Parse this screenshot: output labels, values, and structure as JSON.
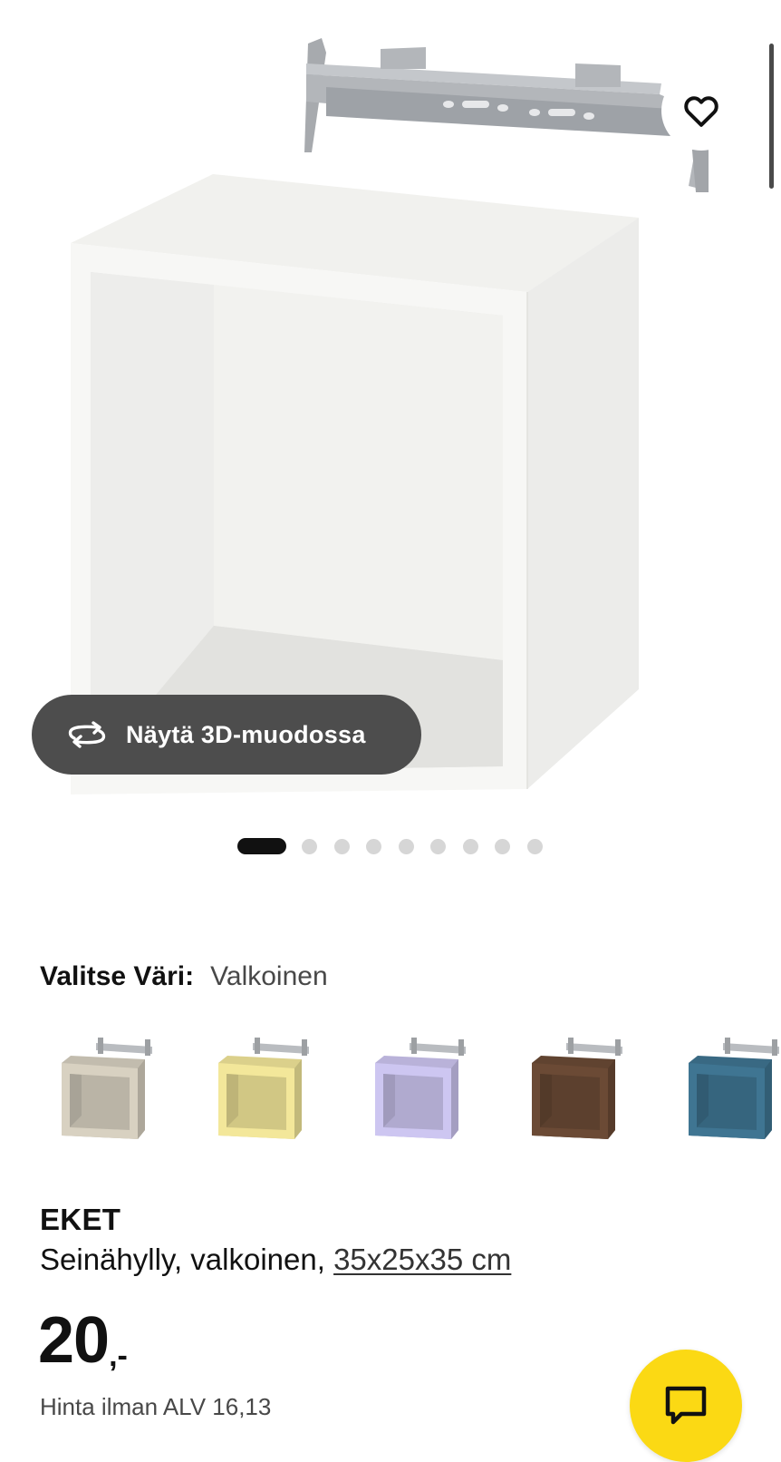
{
  "product": {
    "view3d_label": "Näytä 3D-muodossa",
    "images": {
      "count": 9,
      "active_index": 0
    },
    "color_selector": {
      "label": "Valitse Väri:",
      "selected": "Valkoinen",
      "swatches": [
        {
          "color": "#d8d1c1",
          "bracket": "#b9bcc0"
        },
        {
          "color": "#f3e79a",
          "bracket": "#b9bcc0"
        },
        {
          "color": "#cdc6f1",
          "bracket": "#b9bcc0"
        },
        {
          "color": "#6b4a35",
          "bracket": "#b9bcc0"
        },
        {
          "color": "#3f7592",
          "bracket": "#b9bcc0"
        }
      ]
    },
    "name": "EKET",
    "description_prefix": "Seinähylly, valkoinen, ",
    "size": "35x25x35 cm",
    "price": {
      "integer": "20",
      "suffix": ",-",
      "vat_note": "Hinta ilman ALV 16,13"
    }
  },
  "icons": {
    "favorite": "heart-icon",
    "rotate": "rotate-3d-icon",
    "chat": "chat-icon"
  },
  "colors": {
    "chat_button": "#fbd914",
    "view3d_button": "#4d4d4d",
    "dot_active": "#111111",
    "dot_inactive": "#d6d6d6"
  }
}
